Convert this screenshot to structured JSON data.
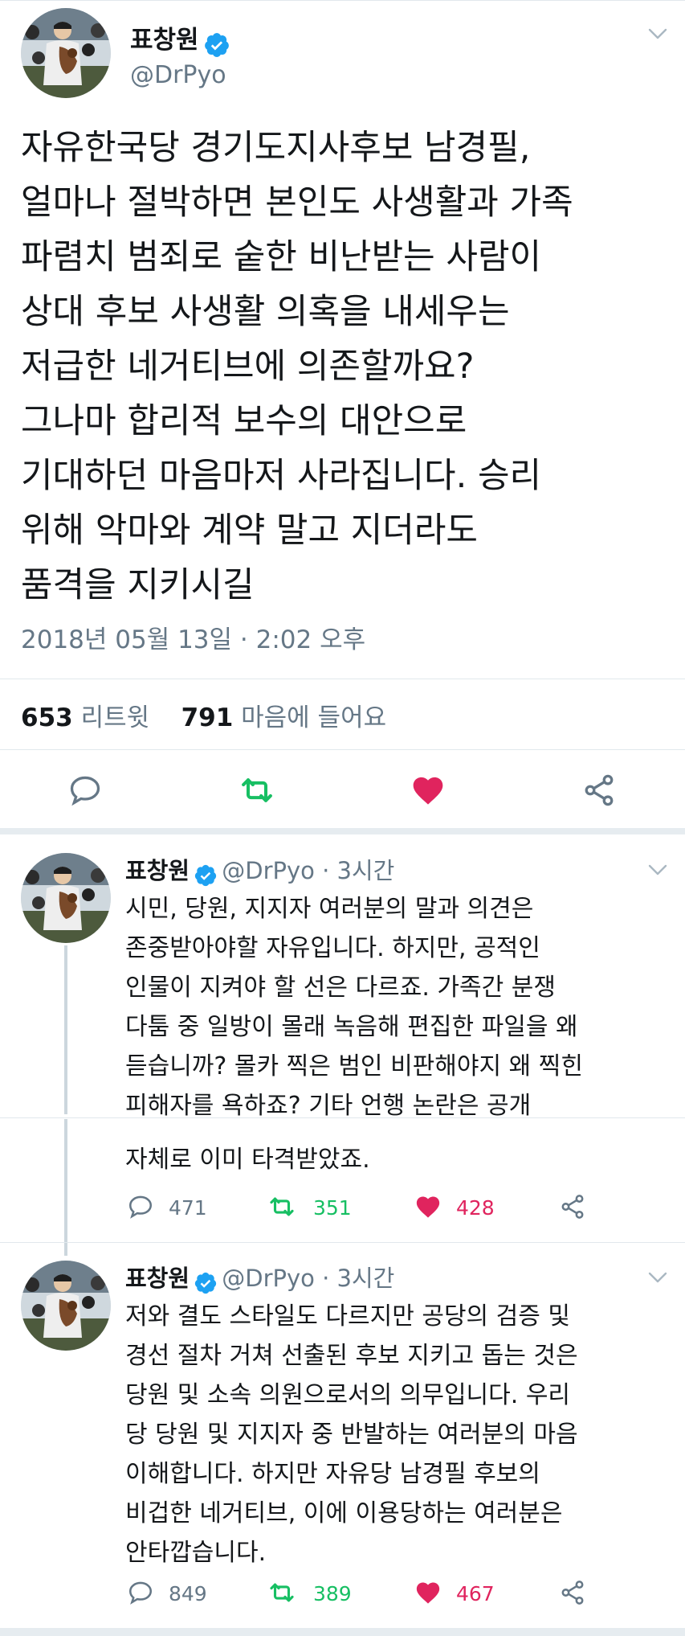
{
  "main_tweet": {
    "name": "표창원",
    "handle": "@DrPyo",
    "text": "자유한국당 경기도지사후보 남경필,\n얼마나 절박하면 본인도 사생활과 가족\n파렴치 범죄로 숱한 비난받는 사람이\n상대 후보 사생활 의혹을 내세우는\n저급한 네거티브에 의존할까요?\n그나마 합리적 보수의 대안으로\n기대하던 마음마저 사라집니다. 승리\n위해 악마와 계약 말고 지더라도\n품격을 지키시길",
    "timestamp": "2018년 05월 13일 · 2:02 오후",
    "retweets": "653",
    "retweets_label": "리트윗",
    "likes": "791",
    "likes_label": "마음에 들어요"
  },
  "replies": [
    {
      "name": "표창원",
      "handle": "@DrPyo · 3시간",
      "text": "시민, 당원, 지지자 여러분의 말과 의견은\n존중받아야할 자유입니다. 하지만, 공적인\n인물이 지켜야 할 선은 다르죠. 가족간 분쟁\n다툼 중 일방이 몰래 녹음해 편집한 파일을 왜\n듣습니까? 몰카 찍은 범인 비판해야지 왜 찍힌\n피해자를 욕하죠? 기타 언행 논란은 공개",
      "text_cont": "자체로 이미 타격받았죠.",
      "replies": "471",
      "retweets": "351",
      "likes": "428"
    },
    {
      "name": "표창원",
      "handle": "@DrPyo · 3시간",
      "text": "저와 결도 스타일도 다르지만 공당의 검증 및\n경선 절차 거쳐 선출된 후보 지키고 돕는 것은\n당원 및 소속 의원으로서의 의무입니다. 우리\n당 당원 및 지지자 중 반발하는 여러분의 마음\n이해합니다. 하지만 자유당 남경필 후보의\n비겁한 네거티브, 이에 이용당하는 여러분은\n안타깝습니다.",
      "replies": "849",
      "retweets": "389",
      "likes": "467"
    }
  ],
  "colors": {
    "verified": "#1da1f2",
    "retweet": "#17bf63",
    "like": "#e0245e",
    "secondary_text": "#657786"
  },
  "icons": [
    "verified-icon",
    "chevron-down-icon",
    "reply-icon",
    "retweet-icon",
    "like-icon",
    "share-icon"
  ]
}
